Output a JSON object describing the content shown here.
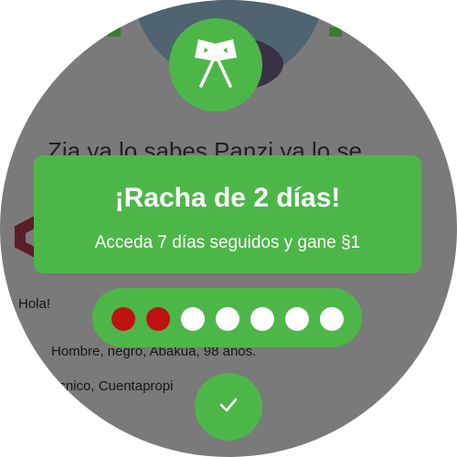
{
  "background": {
    "name_text": "Zia ya lo sabes Panzi ya lo se",
    "greeting": "Hola!",
    "description": "Hombre, negro, Abakua, 98 años.",
    "profession": "écnico, Cuentapropi"
  },
  "streak": {
    "icon": "crossed-flags-icon",
    "title": "¡Racha de 2 días!",
    "subtitle": "Acceda 7 días seguidos y gane §1",
    "days_total": 7,
    "days_completed": 2,
    "completed_color": "#c01212",
    "accent_color": "#4cb748"
  },
  "confirm": {
    "icon": "checkmark-icon"
  }
}
